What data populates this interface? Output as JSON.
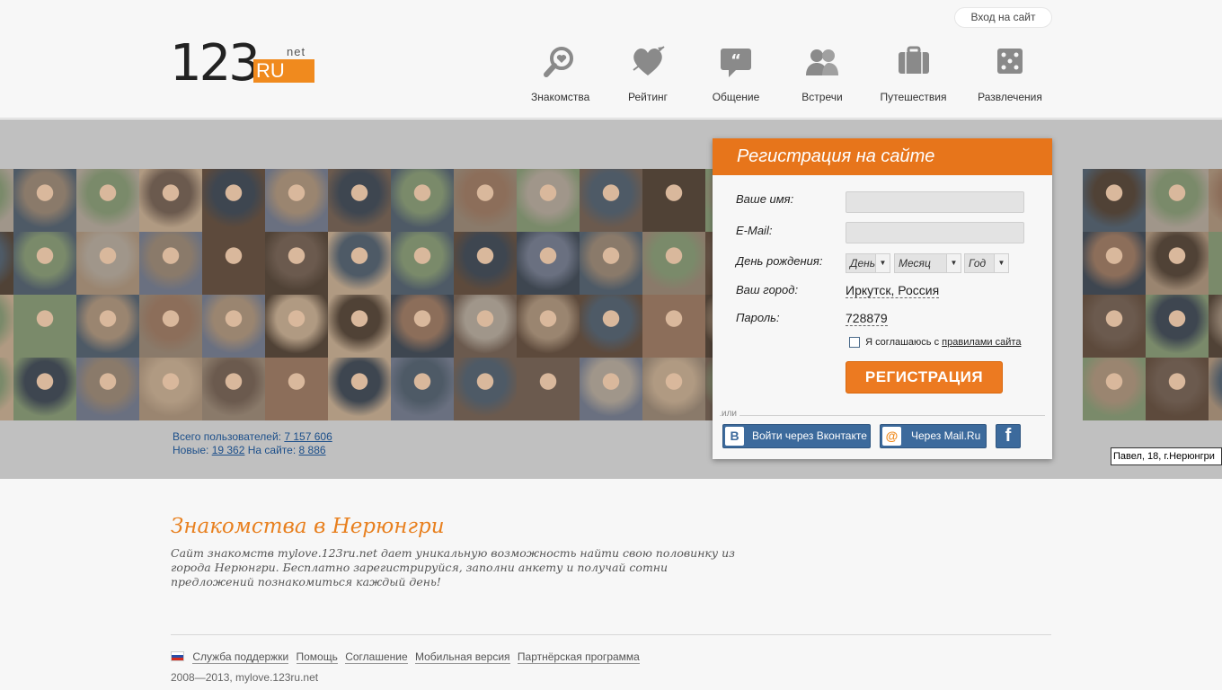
{
  "header": {
    "login_label": "Вход на сайт",
    "logo": {
      "digits": "123",
      "ru": "RU",
      "net": "net"
    },
    "nav": [
      {
        "id": "dating",
        "label": "Знакомства",
        "icon": "search-heart-icon"
      },
      {
        "id": "rating",
        "label": "Рейтинг",
        "icon": "heart-arrow-icon"
      },
      {
        "id": "chat",
        "label": "Общение",
        "icon": "speech-bubble-icon"
      },
      {
        "id": "meetings",
        "label": "Встречи",
        "icon": "people-icon"
      },
      {
        "id": "travel",
        "label": "Путешествия",
        "icon": "suitcase-icon"
      },
      {
        "id": "fun",
        "label": "Развлечения",
        "icon": "dice-icon"
      }
    ]
  },
  "stats": {
    "total_label": "Всего пользователей:",
    "total": "7 157 606",
    "new_label": "Новые:",
    "new": "19 362",
    "online_label": "На сайте:",
    "online": "8 886"
  },
  "tooltip": "Павел, 18, г.Нерюнгри",
  "registration": {
    "title": "Регистрация на сайте",
    "name_label": "Ваше имя:",
    "name_value": "",
    "email_label": "E-Mail:",
    "email_value": "",
    "birthday_label": "День рождения:",
    "day": "День",
    "month": "Месяц",
    "year": "Год",
    "city_label": "Ваш город:",
    "city_value": "Иркутск, Россия",
    "password_label": "Пароль:",
    "password_value": "728879",
    "agree_text": "Я соглашаюсь с",
    "agree_link": "правилами сайта",
    "submit": "РЕГИСТРАЦИЯ",
    "or": "или",
    "vk": "Войти через Вконтакте",
    "mailru": "Через Mail.Ru",
    "fb": "f"
  },
  "description": {
    "title": "Знакомства в Нерюнгри",
    "text": "Сайт знакомств mylove.123ru.net дает уникальную возможность найти свою половинку из города Нерюнгри. Бесплатно зарегистрируйся, заполни анкету и получай сотни предложений познакомиться каждый день!"
  },
  "footer": {
    "links": [
      "Служба поддержки",
      "Помощь",
      "Соглашение",
      "Мобильная версия",
      "Партнёрская программа"
    ],
    "copyright": "2008—2013, mylove.123ru.net"
  },
  "colors": {
    "accent": "#e7751b",
    "link": "#1c4f8a",
    "social_blue": "#3c6a9c"
  }
}
